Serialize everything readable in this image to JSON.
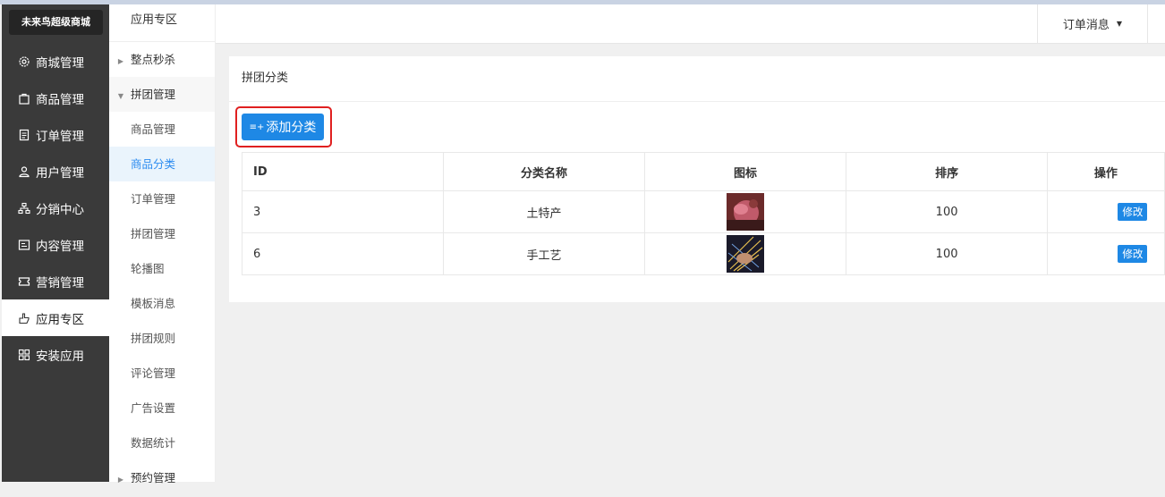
{
  "brand": "未来鸟超级商城",
  "sidebar": {
    "items": [
      {
        "label": "商城管理",
        "icon": "gear-icon"
      },
      {
        "label": "商品管理",
        "icon": "bag-icon"
      },
      {
        "label": "订单管理",
        "icon": "document-icon"
      },
      {
        "label": "用户管理",
        "icon": "user-icon"
      },
      {
        "label": "分销中心",
        "icon": "network-icon"
      },
      {
        "label": "内容管理",
        "icon": "content-icon"
      },
      {
        "label": "营销管理",
        "icon": "ticket-icon"
      },
      {
        "label": "应用专区",
        "icon": "hand-icon",
        "active": true
      },
      {
        "label": "安装应用",
        "icon": "grid-icon"
      }
    ]
  },
  "submenu": {
    "header": "应用专区",
    "items": [
      {
        "label": "整点秒杀"
      },
      {
        "label": "拼团管理"
      },
      {
        "label": "商品管理"
      },
      {
        "label": "商品分类"
      },
      {
        "label": "订单管理"
      },
      {
        "label": "拼团管理"
      },
      {
        "label": "轮播图"
      },
      {
        "label": "模板消息"
      },
      {
        "label": "拼团规则"
      },
      {
        "label": "评论管理"
      },
      {
        "label": "广告设置"
      },
      {
        "label": "数据统计"
      },
      {
        "label": "预约管理"
      }
    ]
  },
  "header": {
    "messages_label": "订单消息"
  },
  "main": {
    "title": "拼团分类",
    "add_button": "添加分类",
    "columns": [
      "ID",
      "分类名称",
      "图标",
      "排序",
      "操作"
    ],
    "rows": [
      {
        "id": "3",
        "name": "土特产",
        "icon": "photo-thumbnail",
        "sort": "100",
        "action": "修改"
      },
      {
        "id": "6",
        "name": "手工艺",
        "icon": "photo-thumbnail",
        "sort": "100",
        "action": "修改"
      }
    ]
  },
  "colors": {
    "sidebar_bg": "#3a3a3a",
    "primary": "#1e88e5",
    "highlight_box": "#e02020",
    "sort_value": "#d9534f"
  }
}
